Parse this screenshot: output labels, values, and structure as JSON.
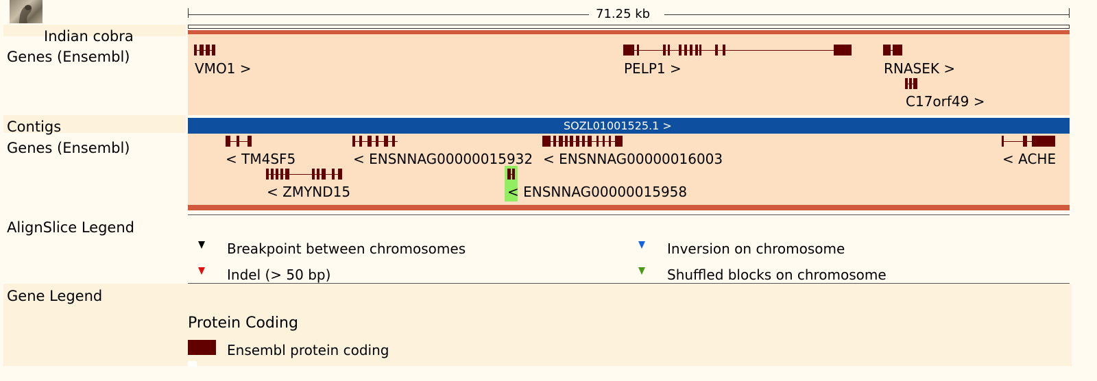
{
  "species": {
    "name": "Indian cobra",
    "icon": "cobra-photo-icon"
  },
  "scale": {
    "label": "71.25 kb"
  },
  "tracks": {
    "genes_top_label": "Genes (Ensembl)",
    "contigs_label": "Contigs",
    "contig_name": "SOZL01001525.1 >",
    "genes_bottom_label": "Genes (Ensembl)"
  },
  "genes_top": [
    {
      "name": "VMO1 >"
    },
    {
      "name": "PELP1 >"
    },
    {
      "name": "RNASEK >"
    },
    {
      "name": "C17orf49 >"
    }
  ],
  "genes_bottom": [
    {
      "name": "< TM4SF5"
    },
    {
      "name": "< ENSNNAG00000015932"
    },
    {
      "name": "< ENSNNAG00000016003"
    },
    {
      "name": "< ACHE"
    },
    {
      "name": "< ZMYND15"
    },
    {
      "name": "< ENSNNAG00000015958"
    }
  ],
  "alignslice_legend": {
    "title": "AlignSlice Legend",
    "items": [
      {
        "label": "Breakpoint between chromosomes",
        "color": "#000000"
      },
      {
        "label": "Inversion on chromosome",
        "color": "#1565e0"
      },
      {
        "label": "Indel (> 50 bp)",
        "color": "#e01010"
      },
      {
        "label": "Shuffled blocks on chromosome",
        "color": "#4c9a16"
      }
    ]
  },
  "gene_legend": {
    "title": "Gene Legend",
    "section": "Protein Coding",
    "item_label": "Ensembl protein coding",
    "item_color": "#620000"
  },
  "colors": {
    "track_bg": "#fde0c2",
    "label_band": "#fdf3dc",
    "feature": "#620000",
    "contig": "#0f4f9f",
    "highlight": "#90ee60",
    "edge_bar": "#d25a3c"
  }
}
